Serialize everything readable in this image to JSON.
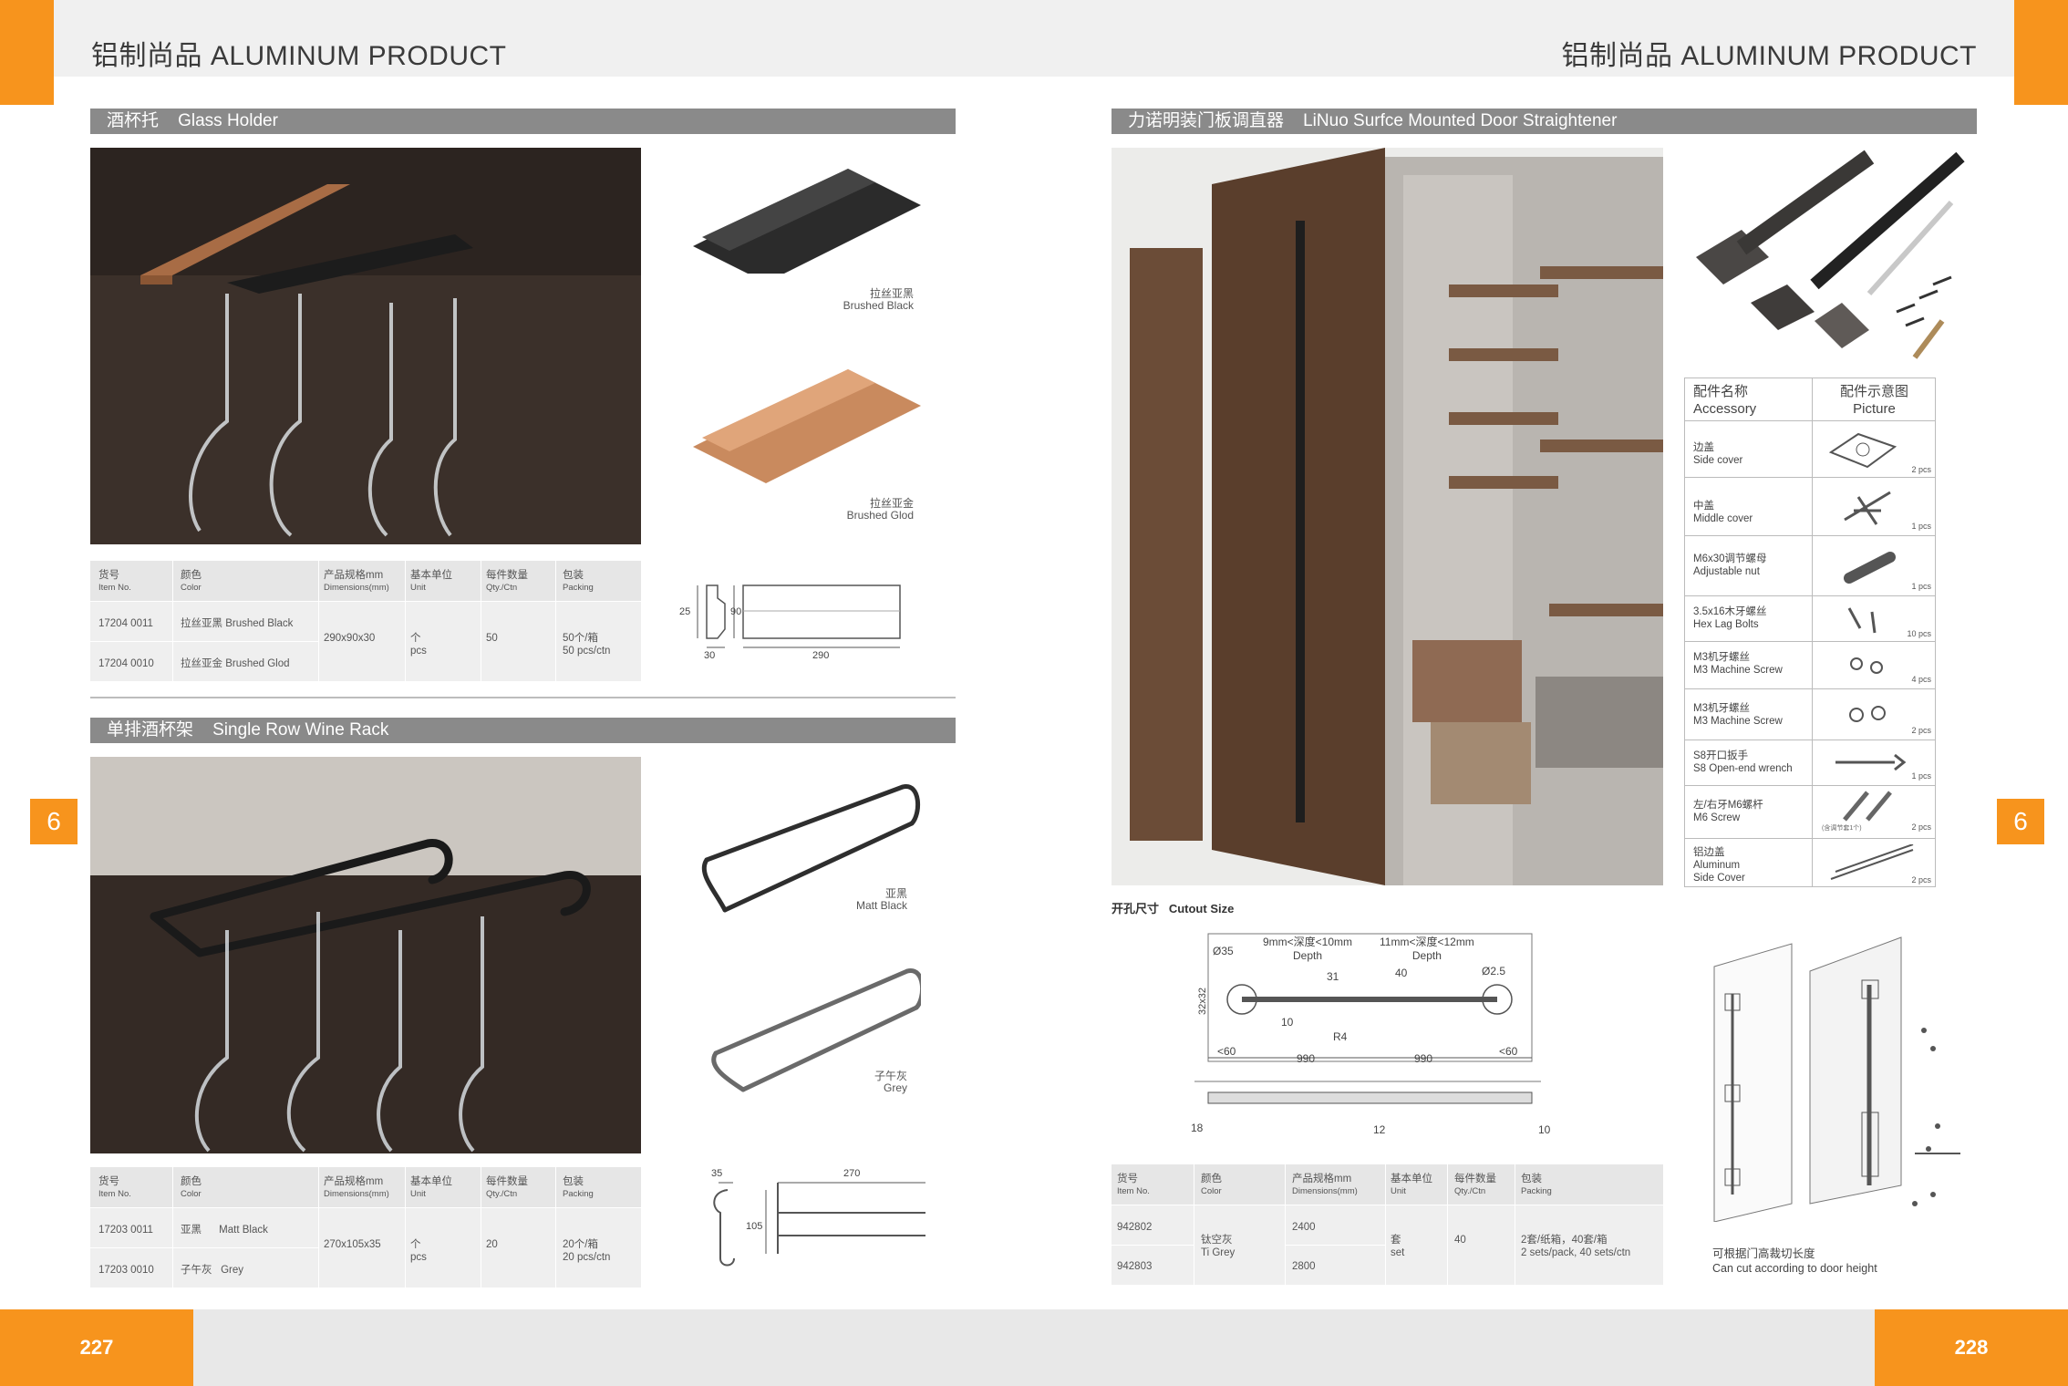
{
  "header": {
    "left_title": "铝制尚品  ALUMINUM PRODUCT",
    "right_title": "铝制尚品  ALUMINUM PRODUCT"
  },
  "side_tabs": {
    "left": "6",
    "right": "6"
  },
  "footer": {
    "left_page": "227",
    "right_page": "228"
  },
  "glass_holder": {
    "bar": "酒杯托    Glass Holder",
    "variants": [
      {
        "cn": "拉丝亚黑",
        "en": "Brushed Black",
        "color": "#2b2b2b"
      },
      {
        "cn": "拉丝亚金",
        "en": "Brushed Glod",
        "color": "#c98a5e"
      }
    ],
    "table": {
      "headers": [
        {
          "cn": "货号",
          "en": "Item No."
        },
        {
          "cn": "颜色",
          "en": "Color"
        },
        {
          "cn": "产品规格mm",
          "en": "Dimensions(mm)"
        },
        {
          "cn": "基本单位",
          "en": "Unit"
        },
        {
          "cn": "每件数量",
          "en": "Qty./Ctn"
        },
        {
          "cn": "包装",
          "en": "Packing"
        }
      ],
      "rows": [
        {
          "item": "17204 0011",
          "color": "拉丝亚黑  Brushed Black"
        },
        {
          "item": "17204 0010",
          "color": "拉丝亚金  Brushed Glod"
        }
      ],
      "dimensions": "290x90x30",
      "unit_cn": "个",
      "unit_en": "pcs",
      "qty": "50",
      "packing_cn": "50个/箱",
      "packing_en": "50 pcs/ctn"
    },
    "dims": {
      "a": "25",
      "b": "90",
      "c": "30",
      "d": "290"
    }
  },
  "wine_rack": {
    "bar": "单排酒杯架    Single Row Wine Rack",
    "variants": [
      {
        "cn": "亚黑",
        "en": "Matt Black",
        "color": "#333333"
      },
      {
        "cn": "子午灰",
        "en": "Grey",
        "color": "#6e6e6e"
      }
    ],
    "table": {
      "headers": [
        {
          "cn": "货号",
          "en": "Item No."
        },
        {
          "cn": "颜色",
          "en": "Color"
        },
        {
          "cn": "产品规格mm",
          "en": "Dimensions(mm)"
        },
        {
          "cn": "基本单位",
          "en": "Unit"
        },
        {
          "cn": "每件数量",
          "en": "Qty./Ctn"
        },
        {
          "cn": "包装",
          "en": "Packing"
        }
      ],
      "rows": [
        {
          "item": "17203 0011",
          "color": "亚黑      Matt Black"
        },
        {
          "item": "17203 0010",
          "color": "子午灰   Grey"
        }
      ],
      "dimensions": "270x105x35",
      "unit_cn": "个",
      "unit_en": "pcs",
      "qty": "20",
      "packing_cn": "20个/箱",
      "packing_en": "20 pcs/ctn"
    },
    "dims": {
      "a": "35",
      "b": "270",
      "c": "105"
    }
  },
  "straightener": {
    "bar": "力诺明装门板调直器    LiNuo Surfce Mounted Door Straightener",
    "cutout_title": "开孔尺寸   Cutout Size",
    "cutout": {
      "d35": "Ø35",
      "depth1": "9mm<深度<10mm",
      "depth1_en": "Depth",
      "depth2": "11mm<深度<12mm",
      "depth2_en": "Depth",
      "d25": "Ø2.5",
      "n31": "31",
      "n40": "40",
      "n32": "32x32",
      "n10": "10",
      "r4": "R4",
      "lt60a": "<60",
      "lt60b": "<60",
      "n990a": "990",
      "n990b": "990",
      "n18": "18",
      "n12": "12",
      "n10b": "10"
    },
    "accessory_header": {
      "name_cn": "配件名称",
      "name_en": "Accessory",
      "pic_cn": "配件示意图",
      "pic_en": "Picture"
    },
    "accessories": [
      {
        "cn": "边盖",
        "en": "Side cover",
        "qty": "2 pcs"
      },
      {
        "cn": "中盖",
        "en": "Middle cover",
        "qty": "1 pcs"
      },
      {
        "cn": "M6x30调节螺母",
        "en": "Adjustable nut",
        "qty": "1 pcs"
      },
      {
        "cn": "3.5x16木牙螺丝",
        "en": "Hex Lag Bolts",
        "qty": "10 pcs"
      },
      {
        "cn": "M3机牙螺丝",
        "en": "M3 Machine Screw",
        "qty": "4 pcs"
      },
      {
        "cn": "M3机牙螺丝",
        "en": "M3 Machine Screw",
        "qty": "2 pcs"
      },
      {
        "cn": "S8开口扳手",
        "en": "S8 Open-end wrench",
        "qty": "1 pcs"
      },
      {
        "cn": "左/右牙M6螺杆",
        "en": "M6 Screw",
        "qty": "2 pcs",
        "note": "(含调节套1个)"
      },
      {
        "cn": "铝边盖",
        "en": "Aluminum",
        "en2": "Side Cover",
        "qty": "2 pcs"
      }
    ],
    "table": {
      "headers": [
        {
          "cn": "货号",
          "en": "Item No."
        },
        {
          "cn": "颜色",
          "en": "Color"
        },
        {
          "cn": "产品规格mm",
          "en": "Dimensions(mm)"
        },
        {
          "cn": "基本单位",
          "en": "Unit"
        },
        {
          "cn": "每件数量",
          "en": "Qty./Ctn"
        },
        {
          "cn": "包装",
          "en": "Packing"
        }
      ],
      "rows": [
        {
          "item": "942802",
          "dim": "2400"
        },
        {
          "item": "942803",
          "dim": "2800"
        }
      ],
      "color_cn": "钛空灰",
      "color_en": "Ti Grey",
      "unit_cn": "套",
      "unit_en": "set",
      "qty": "40",
      "packing_cn": "2套/纸箱，40套/箱",
      "packing_en": "2 sets/pack, 40 sets/ctn"
    },
    "cut_note_cn": "可根据门高裁切长度",
    "cut_note_en": "Can cut according to door height"
  }
}
